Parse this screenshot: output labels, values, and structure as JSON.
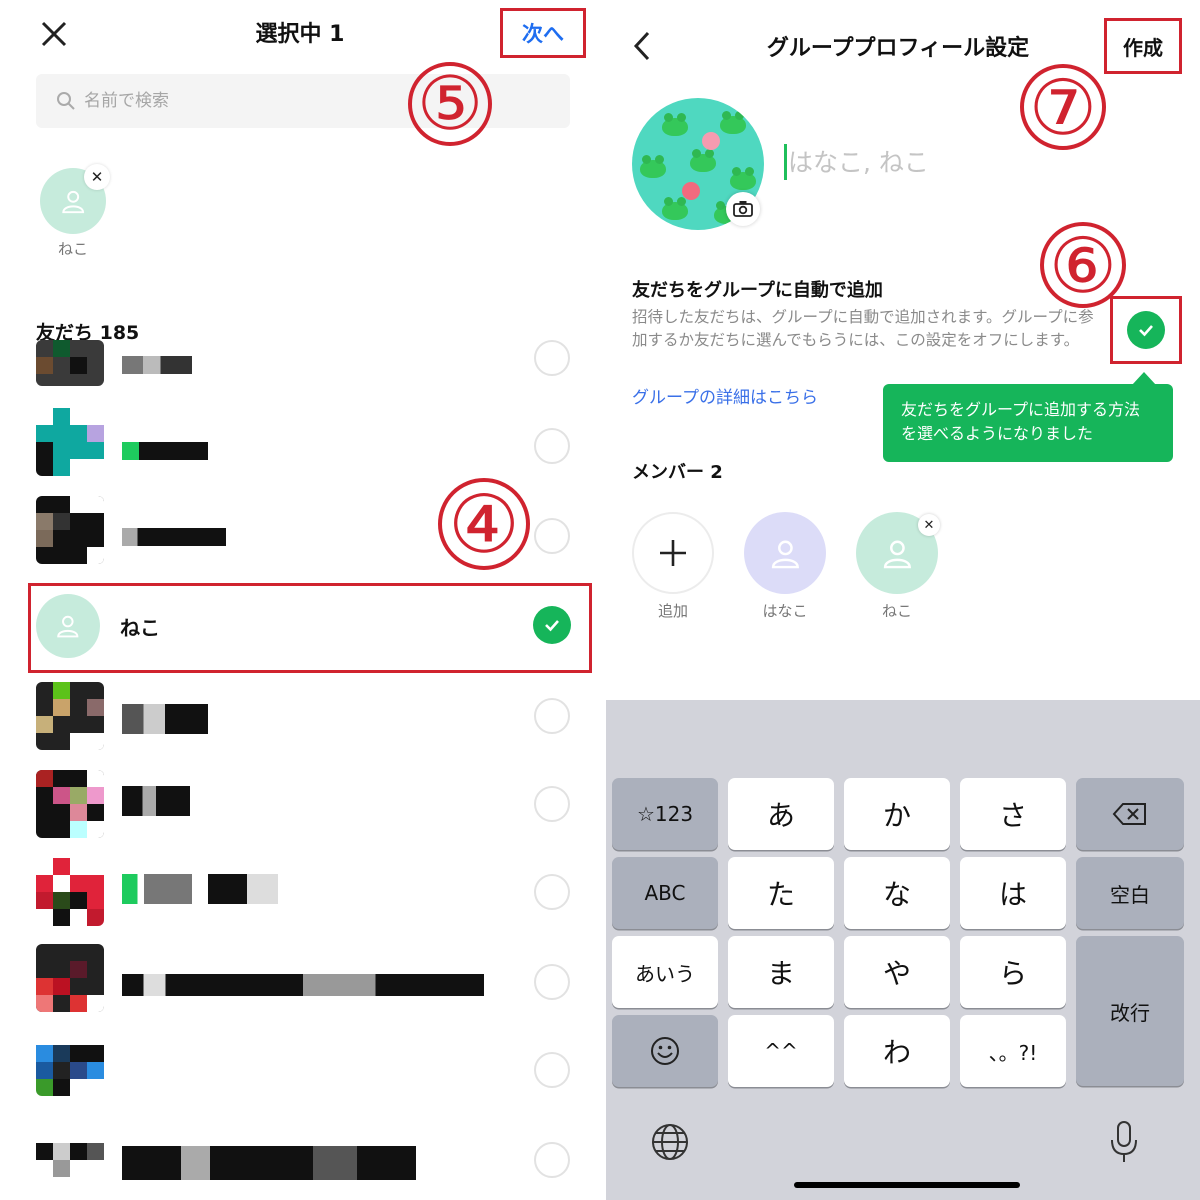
{
  "left": {
    "title": "選択中 1",
    "next_label": "次へ",
    "search_placeholder": "名前で検索",
    "step_select": "④",
    "step_next": "⑤",
    "selected_chip_label": "ねこ",
    "friends_header": "友だち 185",
    "selected_friend_name": "ねこ"
  },
  "right": {
    "title": "グループプロフィール設定",
    "create_label": "作成",
    "step_toggle": "⑥",
    "step_create": "⑦",
    "name_placeholder": "はなこ, ねこ",
    "auto_add_title": "友だちをグループに自動で追加",
    "auto_add_desc": "招待した友だちは、グループに自動で追加されます。グループに参加するか友だちに選んでもらうには、この設定をオフにします。",
    "details_link": "グループの詳細はこちら",
    "tooltip": "友だちをグループに追加する方法を選べるようになりました",
    "members_header": "メンバー 2",
    "members": [
      {
        "label": "追加"
      },
      {
        "label": "はなこ"
      },
      {
        "label": "ねこ"
      }
    ]
  },
  "keyboard": {
    "keys": {
      "symbols": "☆123",
      "a": "あ",
      "ka": "か",
      "sa": "さ",
      "abc": "ABC",
      "ta": "た",
      "na": "な",
      "ha": "は",
      "space": "空白",
      "kana": "あいう",
      "ma": "ま",
      "ya": "や",
      "ra": "ら",
      "return": "改行",
      "emoticon": "^^",
      "wa": "わ",
      "punct": "、。?!"
    }
  },
  "colors": {
    "highlight": "#d0232f",
    "accent_green": "#16b55a",
    "link_blue": "#3a70e8",
    "avatar_mint": "#c6ebdc",
    "avatar_lavender": "#dcdcf8"
  }
}
